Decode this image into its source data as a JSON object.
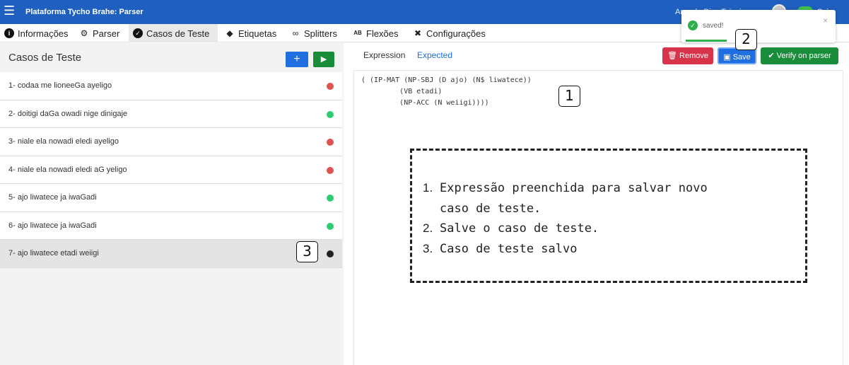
{
  "topbar": {
    "title": "Plataforma Tycho Brahe: Parser",
    "user": "Aracele Dias Teixeira",
    "menu_icon": "hamburger-icon",
    "exit": "Sair"
  },
  "nav": {
    "tabs": [
      {
        "label": "Informações",
        "icon": "info-circle-icon"
      },
      {
        "label": "Parser",
        "icon": "cogs-icon"
      },
      {
        "label": "Casos de Teste",
        "icon": "check-circle-icon"
      },
      {
        "label": "Etiquetas",
        "icon": "tags-icon"
      },
      {
        "label": "Splitters",
        "icon": "link-icon"
      },
      {
        "label": "Flexões",
        "icon": "spell-check-icon"
      },
      {
        "label": "Configurações",
        "icon": "tools-icon"
      }
    ],
    "active": "Casos de Teste"
  },
  "left": {
    "title": "Casos de Teste",
    "add_label": "+",
    "run_label": "▶",
    "cases": [
      {
        "label": "1- codaa me lioneeGa ayeligo",
        "status": "fail"
      },
      {
        "label": "2- doitigi daGa owadi nige dinigaje",
        "status": "pass"
      },
      {
        "label": "3- niale ela nowadi eledi ayeligo",
        "status": "fail"
      },
      {
        "label": "4- niale ela nowadi eledi aG yeligo",
        "status": "fail"
      },
      {
        "label": "5- ajo liwatece ja iwaGadi",
        "status": "pass"
      },
      {
        "label": "6- ajo liwatece ja iwaGadi",
        "status": "pass"
      },
      {
        "label": "7- ajo liwatece etadi weiigi",
        "status": "new"
      }
    ],
    "status_colors": {
      "fail": "#e0524f",
      "pass": "#2ecc71",
      "new": "#222222"
    }
  },
  "right": {
    "tab_expression": "Expression",
    "tab_expected": "Expected",
    "remove_label": "Remove",
    "save_label": "Save",
    "verify_label": "Verify on parser",
    "code": [
      "( (IP-MAT (NP-SBJ (D ajo) (N$ liwatece))",
      "         (VB etadi)",
      "         (NP-ACC (N weiigi))))"
    ]
  },
  "toast": {
    "message": "saved!",
    "close": "×"
  },
  "annotations": {
    "callout_1": "1",
    "callout_2": "2",
    "callout_3": "3",
    "notes": [
      {
        "num": "1.",
        "text": "Expressão preenchida para salvar novo\ncaso de teste."
      },
      {
        "num": "2.",
        "text": "Salve o caso de teste."
      },
      {
        "num": "3.",
        "text": "Caso de teste salvo"
      }
    ]
  }
}
